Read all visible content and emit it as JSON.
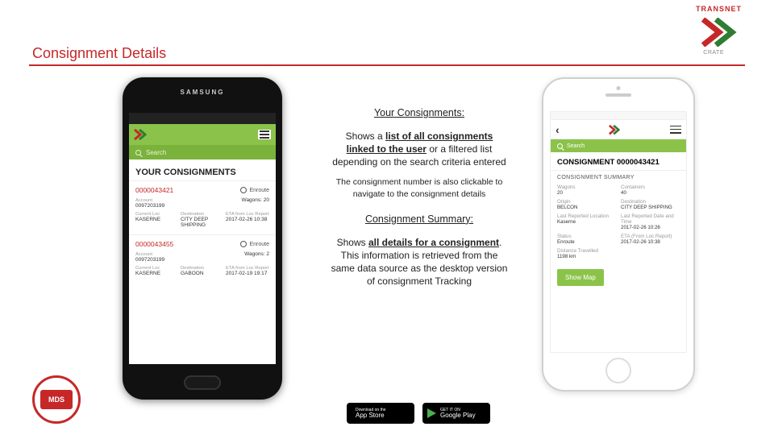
{
  "brand": {
    "name": "TRANSNET",
    "sub": "CRATE"
  },
  "title": "Consignment Details",
  "text": {
    "h1": "Your Consignments:",
    "p1_pre": "Shows a ",
    "p1_bold": "list of all consignments linked to the user",
    "p1_post": " or a filtered list depending on the search criteria entered",
    "p1_sub": "The consignment number is also clickable to navigate to the consignment details",
    "h2": "Consignment Summary:",
    "p2_pre": "Shows ",
    "p2_bold": "all details for a consignment",
    "p2_post": ". This information is retrieved from the same data source as the desktop version of consignment Tracking"
  },
  "samsung": {
    "brand": "SAMSUNG",
    "search": "Search",
    "header": "YOUR CONSIGNMENTS",
    "cards": [
      {
        "num": "0000043421",
        "status": "Enroute",
        "acct_lbl": "Account",
        "acct": "0097203199",
        "wag_lbl": "Wagons: 20",
        "c1_lbl": "Current Loc",
        "c1": "KASERNE",
        "c2_lbl": "Destination",
        "c2": "CITY DEEP SHIPPING",
        "c3_lbl": "ETA from Loc Report",
        "c3": "2017-02-26 10:38"
      },
      {
        "num": "0000043455",
        "status": "Enroute",
        "acct_lbl": "Account",
        "acct": "0097203199",
        "wag_lbl": "Wagons: 2",
        "c1_lbl": "Current Loc",
        "c1": "KASERNE",
        "c2_lbl": "Destination",
        "c2": "GABOON",
        "c3_lbl": "ETA from Loc Report",
        "c3": "2017-02-19 19:17"
      }
    ]
  },
  "iphone": {
    "search": "Search",
    "title": "CONSIGNMENT 0000043421",
    "sub": "CONSIGNMENT SUMMARY",
    "rows": [
      {
        "l1": "Wagons",
        "v1": "20",
        "l2": "Containers",
        "v2": "40"
      },
      {
        "l1": "Origin",
        "v1": "BELCON",
        "l2": "Destination",
        "v2": "CITY DEEP SHIPPING"
      },
      {
        "l1": "Last Reported Location",
        "v1": "Kaserne",
        "l2": "Last Reported Date and Time",
        "v2": "2017-02-26 10:26"
      },
      {
        "l1": "Status",
        "v1": "Enroute",
        "l2": "ETA (From Loc Report)",
        "v2": "2017-02-26 10:38"
      },
      {
        "l1": "Distance Travelled",
        "v1": "1198 km",
        "l2": "",
        "v2": ""
      }
    ],
    "map": "Show Map"
  },
  "stores": {
    "apple_s": "Download on the",
    "apple_b": "App Store",
    "google_s": "GET IT ON",
    "google_b": "Google Play"
  },
  "mds": "MDS"
}
